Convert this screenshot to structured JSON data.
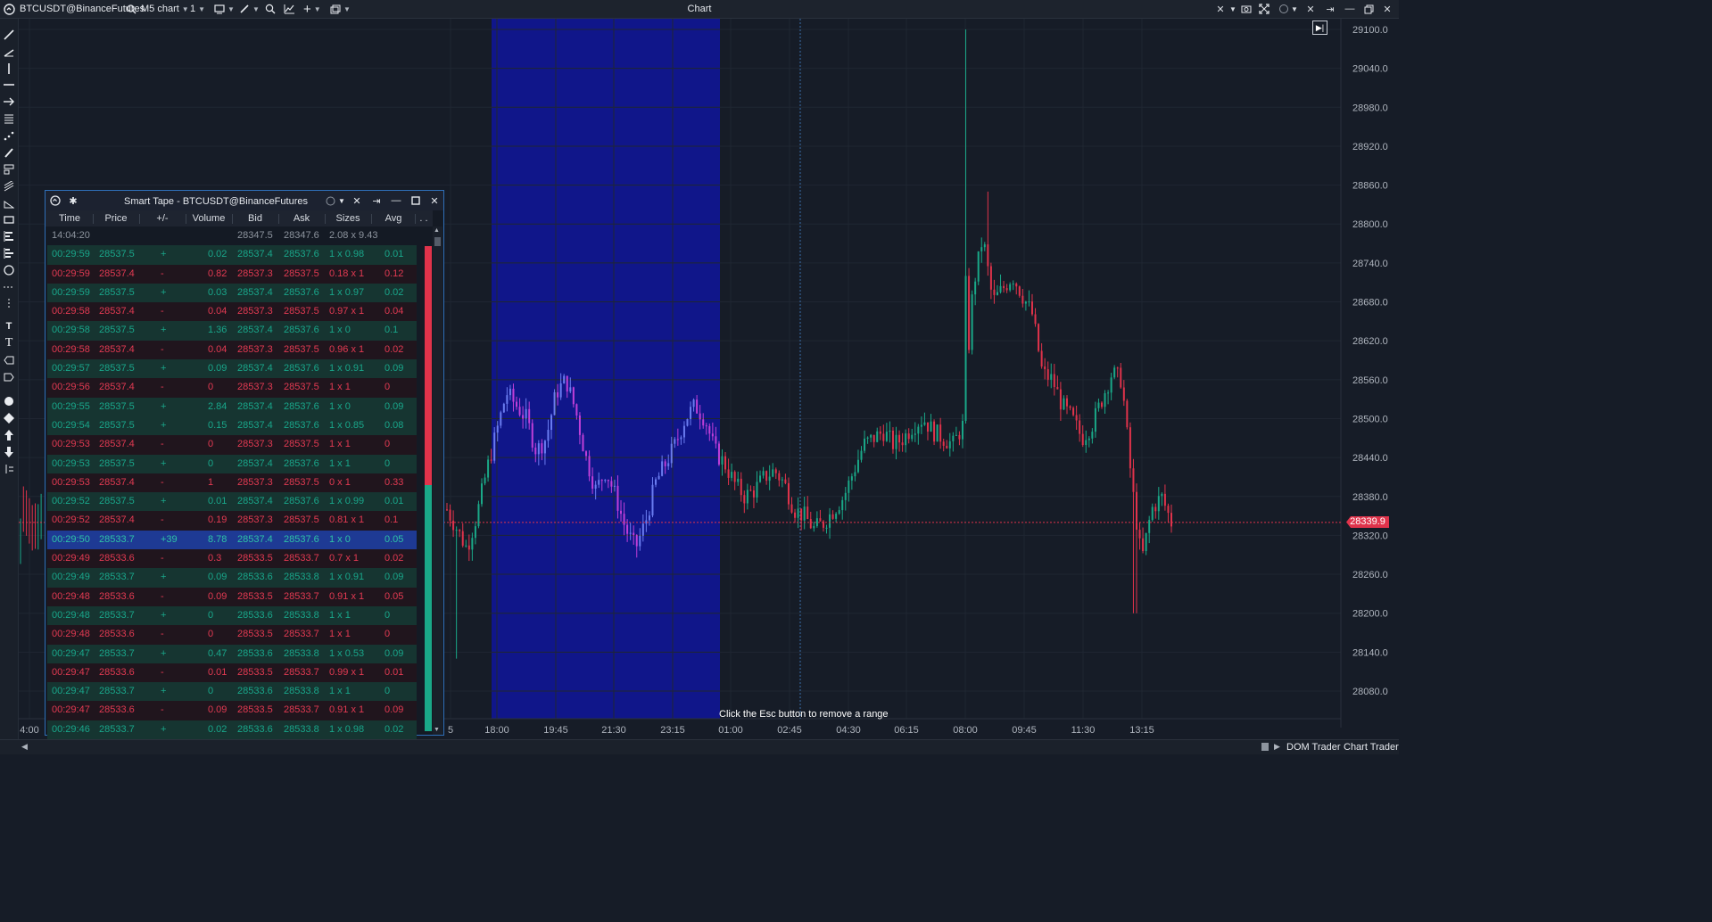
{
  "toolbar": {
    "symbol": "BTCUSDT@BinanceFutures",
    "chart_type": "M5 chart",
    "count": "1",
    "title": "Chart"
  },
  "chart": {
    "current_price": "28339.9",
    "esc_hint": "Click the Esc button to remove a range",
    "y_labels": [
      "29100.0",
      "29040.0",
      "28980.0",
      "28920.0",
      "28860.0",
      "28800.0",
      "28740.0",
      "28680.0",
      "28620.0",
      "28560.0",
      "28500.0",
      "28440.0",
      "28380.0",
      "28320.0",
      "28260.0",
      "28200.0",
      "28140.0",
      "28080.0"
    ],
    "y_range": [
      28060,
      29110
    ],
    "x_labels": [
      "4:00",
      "5",
      "18:00",
      "19:45",
      "21:30",
      "23:15",
      "01:00",
      "02:45",
      "04:30",
      "06:15",
      "08:00",
      "09:45",
      "11:30",
      "13:15"
    ],
    "highlight_range": [
      "18:00",
      "01:00"
    ],
    "colors": {
      "up": "#1aa888",
      "down": "#e0334b",
      "range": "#10168f",
      "background": "#161c27"
    }
  },
  "smart_tape": {
    "title": "Smart Tape - BTCUSDT@BinanceFutures",
    "columns": [
      "Time",
      "Price",
      "+/-",
      "Volume",
      "Bid",
      "Ask",
      "Sizes",
      "Avg"
    ],
    "rows": [
      {
        "time": "14:04:20",
        "price": "",
        "diff": "",
        "volume": "",
        "bid": "28347.5",
        "ask": "28347.6",
        "sizes": "2.08 x 9.43",
        "avg": "",
        "side": "neutral"
      },
      {
        "time": "00:29:59",
        "price": "28537.5",
        "diff": "+",
        "volume": "0.02",
        "bid": "28537.4",
        "ask": "28537.6",
        "sizes": "1 x 0.98",
        "avg": "0.01",
        "side": "buy"
      },
      {
        "time": "00:29:59",
        "price": "28537.4",
        "diff": "-",
        "volume": "0.82",
        "bid": "28537.3",
        "ask": "28537.5",
        "sizes": "0.18 x 1",
        "avg": "0.12",
        "side": "sell"
      },
      {
        "time": "00:29:59",
        "price": "28537.5",
        "diff": "+",
        "volume": "0.03",
        "bid": "28537.4",
        "ask": "28537.6",
        "sizes": "1 x 0.97",
        "avg": "0.02",
        "side": "buy"
      },
      {
        "time": "00:29:58",
        "price": "28537.4",
        "diff": "-",
        "volume": "0.04",
        "bid": "28537.3",
        "ask": "28537.5",
        "sizes": "0.97 x 1",
        "avg": "0.04",
        "side": "sell"
      },
      {
        "time": "00:29:58",
        "price": "28537.5",
        "diff": "+",
        "volume": "1.36",
        "bid": "28537.4",
        "ask": "28537.6",
        "sizes": "1 x 0",
        "avg": "0.1",
        "side": "buy"
      },
      {
        "time": "00:29:58",
        "price": "28537.4",
        "diff": "-",
        "volume": "0.04",
        "bid": "28537.3",
        "ask": "28537.5",
        "sizes": "0.96 x 1",
        "avg": "0.02",
        "side": "sell"
      },
      {
        "time": "00:29:57",
        "price": "28537.5",
        "diff": "+",
        "volume": "0.09",
        "bid": "28537.4",
        "ask": "28537.6",
        "sizes": "1 x 0.91",
        "avg": "0.09",
        "side": "buy"
      },
      {
        "time": "00:29:56",
        "price": "28537.4",
        "diff": "-",
        "volume": "0",
        "bid": "28537.3",
        "ask": "28537.5",
        "sizes": "1 x 1",
        "avg": "0",
        "side": "sell"
      },
      {
        "time": "00:29:55",
        "price": "28537.5",
        "diff": "+",
        "volume": "2.84",
        "bid": "28537.4",
        "ask": "28537.6",
        "sizes": "1 x 0",
        "avg": "0.09",
        "side": "buy"
      },
      {
        "time": "00:29:54",
        "price": "28537.5",
        "diff": "+",
        "volume": "0.15",
        "bid": "28537.4",
        "ask": "28537.6",
        "sizes": "1 x 0.85",
        "avg": "0.08",
        "side": "buy"
      },
      {
        "time": "00:29:53",
        "price": "28537.4",
        "diff": "-",
        "volume": "0",
        "bid": "28537.3",
        "ask": "28537.5",
        "sizes": "1 x 1",
        "avg": "0",
        "side": "sell"
      },
      {
        "time": "00:29:53",
        "price": "28537.5",
        "diff": "+",
        "volume": "0",
        "bid": "28537.4",
        "ask": "28537.6",
        "sizes": "1 x 1",
        "avg": "0",
        "side": "buy"
      },
      {
        "time": "00:29:53",
        "price": "28537.4",
        "diff": "-",
        "volume": "1",
        "bid": "28537.3",
        "ask": "28537.5",
        "sizes": "0 x 1",
        "avg": "0.33",
        "side": "sell"
      },
      {
        "time": "00:29:52",
        "price": "28537.5",
        "diff": "+",
        "volume": "0.01",
        "bid": "28537.4",
        "ask": "28537.6",
        "sizes": "1 x 0.99",
        "avg": "0.01",
        "side": "buy"
      },
      {
        "time": "00:29:52",
        "price": "28537.4",
        "diff": "-",
        "volume": "0.19",
        "bid": "28537.3",
        "ask": "28537.5",
        "sizes": "0.81 x 1",
        "avg": "0.1",
        "side": "sell"
      },
      {
        "time": "00:29:50",
        "price": "28533.7",
        "diff": "+39",
        "volume": "8.78",
        "bid": "28537.4",
        "ask": "28537.6",
        "sizes": "1 x 0",
        "avg": "0.05",
        "side": "sel"
      },
      {
        "time": "00:29:49",
        "price": "28533.6",
        "diff": "-",
        "volume": "0.3",
        "bid": "28533.5",
        "ask": "28533.7",
        "sizes": "0.7 x 1",
        "avg": "0.02",
        "side": "sell"
      },
      {
        "time": "00:29:49",
        "price": "28533.7",
        "diff": "+",
        "volume": "0.09",
        "bid": "28533.6",
        "ask": "28533.8",
        "sizes": "1 x 0.91",
        "avg": "0.09",
        "side": "buy"
      },
      {
        "time": "00:29:48",
        "price": "28533.6",
        "diff": "-",
        "volume": "0.09",
        "bid": "28533.5",
        "ask": "28533.7",
        "sizes": "0.91 x 1",
        "avg": "0.05",
        "side": "sell"
      },
      {
        "time": "00:29:48",
        "price": "28533.7",
        "diff": "+",
        "volume": "0",
        "bid": "28533.6",
        "ask": "28533.8",
        "sizes": "1 x 1",
        "avg": "0",
        "side": "buy"
      },
      {
        "time": "00:29:48",
        "price": "28533.6",
        "diff": "-",
        "volume": "0",
        "bid": "28533.5",
        "ask": "28533.7",
        "sizes": "1 x 1",
        "avg": "0",
        "side": "sell"
      },
      {
        "time": "00:29:47",
        "price": "28533.7",
        "diff": "+",
        "volume": "0.47",
        "bid": "28533.6",
        "ask": "28533.8",
        "sizes": "1 x 0.53",
        "avg": "0.09",
        "side": "buy"
      },
      {
        "time": "00:29:47",
        "price": "28533.6",
        "diff": "-",
        "volume": "0.01",
        "bid": "28533.5",
        "ask": "28533.7",
        "sizes": "0.99 x 1",
        "avg": "0.01",
        "side": "sell"
      },
      {
        "time": "00:29:47",
        "price": "28533.7",
        "diff": "+",
        "volume": "0",
        "bid": "28533.6",
        "ask": "28533.8",
        "sizes": "1 x 1",
        "avg": "0",
        "side": "buy"
      },
      {
        "time": "00:29:47",
        "price": "28533.6",
        "diff": "-",
        "volume": "0.09",
        "bid": "28533.5",
        "ask": "28533.7",
        "sizes": "0.91 x 1",
        "avg": "0.09",
        "side": "sell"
      },
      {
        "time": "00:29:46",
        "price": "28533.7",
        "diff": "+",
        "volume": "0.02",
        "bid": "28533.6",
        "ask": "28533.8",
        "sizes": "1 x 0.98",
        "avg": "0.02",
        "side": "buy"
      }
    ]
  },
  "statusbar": {
    "dom_trader": "DOM Trader",
    "chart_trader": "Chart Trader"
  },
  "chart_data": {
    "type": "candlestick",
    "x_labels": [
      "18:00",
      "19:45",
      "21:30",
      "23:15",
      "01:00",
      "02:45",
      "04:30",
      "06:15",
      "08:00",
      "09:45",
      "11:30",
      "13:15"
    ],
    "ylim": [
      28060,
      29110
    ],
    "last_price": 28339.9,
    "closes": [
      28360,
      28330,
      28300,
      28350,
      28420,
      28480,
      28540,
      28520,
      28500,
      28450,
      28470,
      28540,
      28560,
      28510,
      28440,
      28390,
      28420,
      28380,
      28330,
      28300,
      28340,
      28400,
      28430,
      28460,
      28500,
      28520,
      28500,
      28450,
      28430,
      28400,
      28380,
      28390,
      28410,
      28420,
      28400,
      28360,
      28350,
      28330,
      28340,
      28360,
      28380,
      28420,
      28460,
      28470,
      28480,
      28460,
      28470,
      28490,
      28500,
      28480,
      28470,
      28460,
      28490,
      28700,
      28780,
      28680,
      28700,
      28720,
      28690,
      28660,
      28570,
      28560,
      28520,
      28500,
      28470,
      28490,
      28530,
      28570,
      28560,
      28400,
      28280,
      28360,
      28380,
      28340
    ]
  }
}
